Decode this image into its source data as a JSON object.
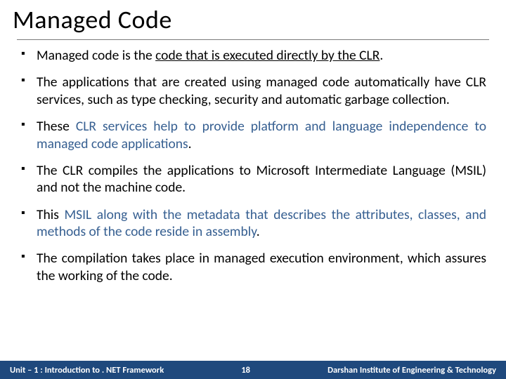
{
  "title": "Managed Code",
  "bullets": {
    "b1_a": "Managed code is the ",
    "b1_b": "code that is executed directly by the CLR",
    "b1_c": ".",
    "b2": "The applications that are created using managed code automatically have CLR services, such as type checking, security and automatic garbage collection.",
    "b3_a": "These ",
    "b3_b": "CLR services help to provide platform and language independence to managed code applications",
    "b3_c": ".",
    "b4": "The CLR compiles the applications to Microsoft Intermediate Language (MSIL) and not the machine code.",
    "b5_a": "This ",
    "b5_b": "MSIL along with the metadata that describes the attributes, classes, and methods of the code reside in assembly",
    "b5_c": ".",
    "b6": "The compilation takes place in managed execution environment, which assures the working of the code."
  },
  "footer": {
    "left": "Unit – 1 : Introduction to . NET Framework",
    "page": "18",
    "right": "Darshan Institute of Engineering & Technology"
  }
}
